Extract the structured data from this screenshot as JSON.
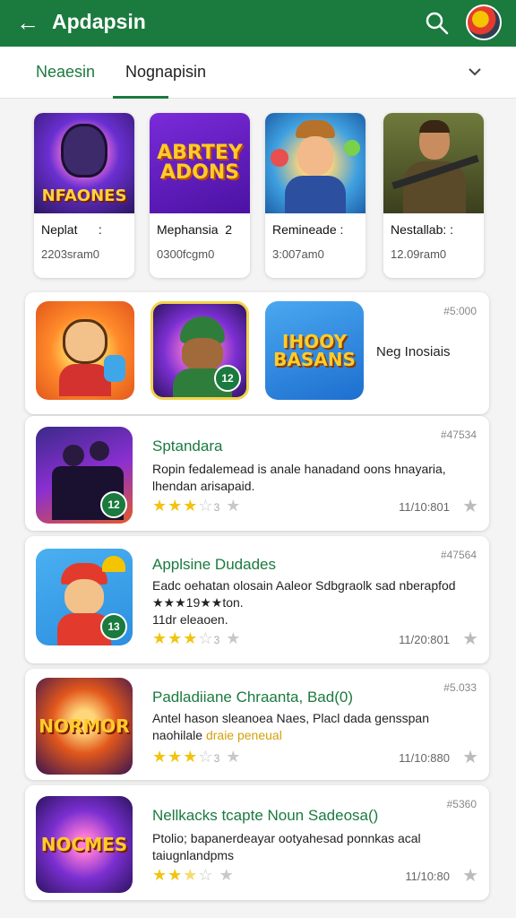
{
  "header": {
    "title": "Apdapsin",
    "back_icon": "arrow-left-icon",
    "search_icon": "search-icon",
    "brand_color": "#1b7a3e"
  },
  "tabs": {
    "tab1": "Neaesin",
    "tab2": "Nognapisin"
  },
  "top_games": [
    {
      "name": "Neplat",
      "name_suffix": ":",
      "meta": "2203sram0",
      "art": "NFAONES"
    },
    {
      "name": "Mephansia",
      "name_suffix": "2",
      "meta": "0300fcgm0",
      "art": "ABRTEY ADONS"
    },
    {
      "name": "Remineade",
      "name_suffix": ":",
      "meta": "3:007am0",
      "art": ""
    },
    {
      "name": "Nestallab:",
      "name_suffix": ":",
      "meta": "12.09ram0",
      "art": ""
    }
  ],
  "featured": {
    "code": "#5:000",
    "label": "Neg Inosiais",
    "art3": "IHOOY BASANS",
    "badge2": "12"
  },
  "list": [
    {
      "title": "Sptandara",
      "desc": "Ropin fedalemead is anale hanadand oons hnayaria, lhendan arisapaid.",
      "code": "#47534",
      "stars_suffix": "3",
      "date": "11/10:801",
      "badge": "12"
    },
    {
      "title": "Applsine Dudades",
      "desc": "Eadc oehatan olosain Aaleor Sdbgraolk sad nberapfod",
      "desc2": "★★★19★★ton.",
      "desc3": "11dr eleaoen.",
      "code": "#47564",
      "stars_suffix": "3",
      "date": "11/20:801",
      "badge": "13"
    },
    {
      "title": "Padladiiane Chraanta, Bad(0)",
      "desc": "Antel hason sleanoea Naes, Placl dada gensspan",
      "desc2": "naohilale",
      "desc2_highlight": "draie peneual",
      "code": "#5.033",
      "stars_suffix": "3",
      "date": "11/10:880",
      "art": "NORMOR"
    },
    {
      "title": "Nellkacks tcapte Noun Sadeosa()",
      "desc": "Ptolio; bapanerdeayar ootyahesad ponnkas acal taiugnlandpms",
      "code": "#5360",
      "stars_suffix": "",
      "date": "11/10:80",
      "art": "NOCMES"
    }
  ]
}
